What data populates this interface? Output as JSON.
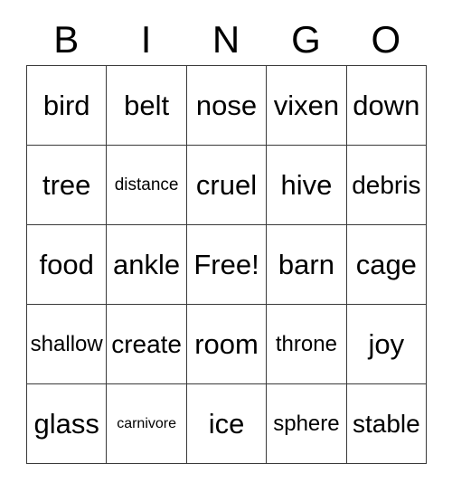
{
  "card": {
    "headers": [
      "B",
      "I",
      "N",
      "G",
      "O"
    ],
    "rows": [
      [
        {
          "label": "bird",
          "size": "size-xl"
        },
        {
          "label": "belt",
          "size": "size-xl"
        },
        {
          "label": "nose",
          "size": "size-xl"
        },
        {
          "label": "vixen",
          "size": "size-xl"
        },
        {
          "label": "down",
          "size": "size-xl"
        }
      ],
      [
        {
          "label": "tree",
          "size": "size-xl"
        },
        {
          "label": "distance",
          "size": "size-s"
        },
        {
          "label": "cruel",
          "size": "size-xl"
        },
        {
          "label": "hive",
          "size": "size-xl"
        },
        {
          "label": "debris",
          "size": "size-l"
        }
      ],
      [
        {
          "label": "food",
          "size": "size-xl"
        },
        {
          "label": "ankle",
          "size": "size-xl"
        },
        {
          "label": "Free!",
          "size": "size-xl"
        },
        {
          "label": "barn",
          "size": "size-xl"
        },
        {
          "label": "cage",
          "size": "size-xl"
        }
      ],
      [
        {
          "label": "shallow",
          "size": "size-m"
        },
        {
          "label": "create",
          "size": "size-l"
        },
        {
          "label": "room",
          "size": "size-xl"
        },
        {
          "label": "throne",
          "size": "size-m"
        },
        {
          "label": "joy",
          "size": "size-xl"
        }
      ],
      [
        {
          "label": "glass",
          "size": "size-xl"
        },
        {
          "label": "carnivore",
          "size": "size-xs"
        },
        {
          "label": "ice",
          "size": "size-xl"
        },
        {
          "label": "sphere",
          "size": "size-m"
        },
        {
          "label": "stable",
          "size": "size-l"
        }
      ]
    ],
    "colors": {
      "grid_line": "#3a3a3a",
      "text": "#000000",
      "background": "#ffffff"
    }
  }
}
